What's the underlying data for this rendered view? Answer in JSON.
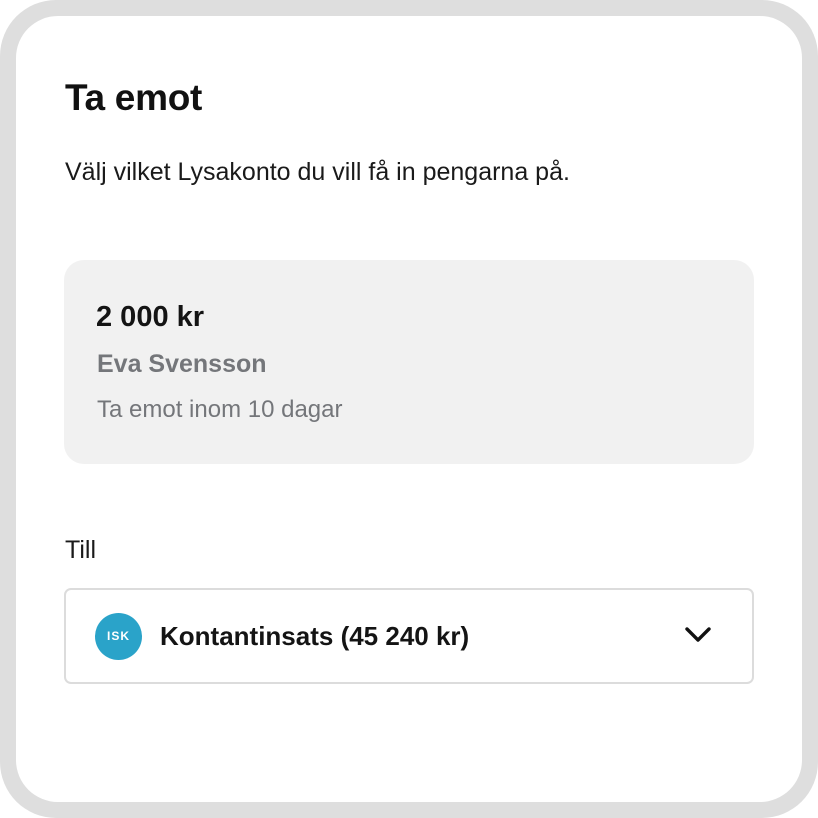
{
  "header": {
    "title": "Ta emot",
    "subtitle": "Välj vilket Lysakonto du vill få in pengarna på."
  },
  "request": {
    "amount": "2 000 kr",
    "sender": "Eva Svensson",
    "deadline": "Ta emot inom 10 dagar"
  },
  "destination": {
    "label": "Till",
    "account_badge": "ISK",
    "account_name": "Kontantinsats (45 240 kr)",
    "icon": "chevron-down-icon"
  },
  "colors": {
    "frame": "#dedede",
    "card": "#ffffff",
    "request_box": "#f1f1f1",
    "muted_text": "#74767a",
    "isk_badge": "#2aa3c9",
    "select_border": "#dcdcdc"
  }
}
